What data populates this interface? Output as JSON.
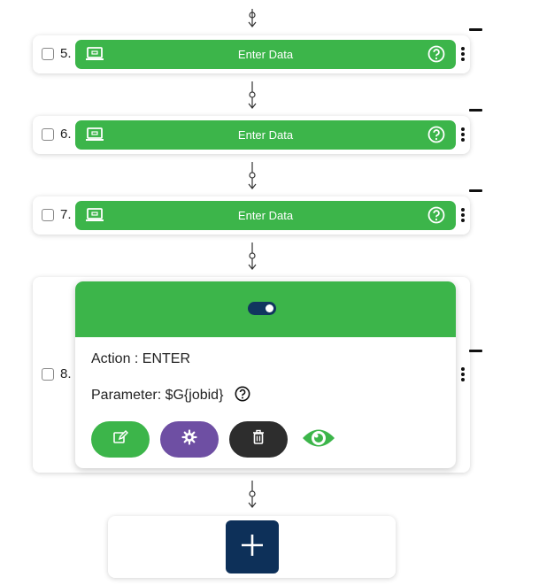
{
  "steps": [
    {
      "number": "5.",
      "title": "Enter Data"
    },
    {
      "number": "6.",
      "title": "Enter Data"
    },
    {
      "number": "7.",
      "title": "Enter Data"
    }
  ],
  "expanded_step": {
    "number": "8.",
    "action_line": "Action : ENTER",
    "parameter_line": "Parameter: $G{jobid}",
    "toggle_on": true
  },
  "colors": {
    "green": "#3cb54a",
    "purple": "#6e4fa3",
    "dark": "#2d2d2d",
    "navy": "#0d3059"
  },
  "icons": {
    "step_icon": "monitor-icon",
    "help": "help-circle-icon",
    "menu": "kebab-menu-icon",
    "edit": "edit-icon",
    "settings": "gear-icon",
    "delete": "trash-icon",
    "view": "eye-icon",
    "add": "plus-icon"
  }
}
